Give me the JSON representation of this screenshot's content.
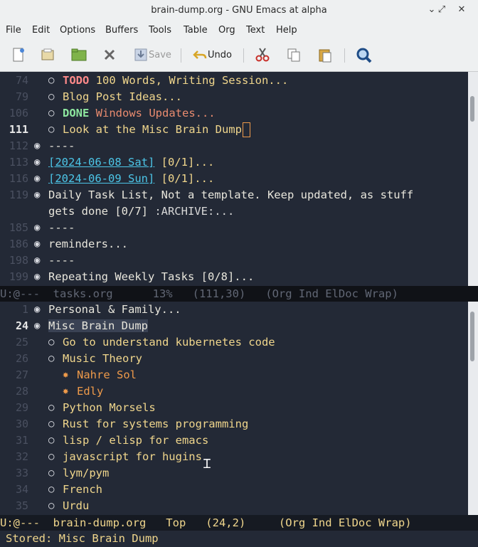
{
  "window": {
    "title": "brain-dump.org - GNU Emacs at alpha"
  },
  "menu": [
    "File",
    "Edit",
    "Options",
    "Buffers",
    "Tools",
    "Table",
    "Org",
    "Text",
    "Help"
  ],
  "toolbar": {
    "save": "Save",
    "undo": "Undo"
  },
  "top_pane": {
    "lines": [
      {
        "n": "74",
        "bullet": "○",
        "lvl": 2,
        "kw": "TODO",
        "kwtype": "todo",
        "text": "100 Words, Writing Session..."
      },
      {
        "n": "79",
        "bullet": "○",
        "lvl": 2,
        "text": "Blog Post Ideas..."
      },
      {
        "n": "106",
        "bullet": "○",
        "lvl": 2,
        "kw": "DONE",
        "kwtype": "done",
        "text": "Windows Updates..."
      },
      {
        "n": "111",
        "bullet": "○",
        "lvl": 2,
        "text": "Look at the Misc Brain Dump",
        "current": true
      },
      {
        "n": "112",
        "bullet": "◉",
        "lvl": 1,
        "text": "----"
      },
      {
        "n": "113",
        "bullet": "◉",
        "lvl": 1,
        "date": "[2024-06-08 Sat]",
        "text": " [0/1]..."
      },
      {
        "n": "116",
        "bullet": "◉",
        "lvl": 1,
        "date": "[2024-06-09 Sun]",
        "text": " [0/1]..."
      },
      {
        "n": "119",
        "bullet": "◉",
        "lvl": 1,
        "text": "Daily Task List, Not a template. Keep updated, as stuff"
      },
      {
        "n": "",
        "bullet": "",
        "lvl": 1,
        "text": "gets done [0/7] ",
        "tag": ":ARCHIVE:..."
      },
      {
        "n": "185",
        "bullet": "◉",
        "lvl": 1,
        "text": "----"
      },
      {
        "n": "186",
        "bullet": "◉",
        "lvl": 1,
        "text": "reminders..."
      },
      {
        "n": "198",
        "bullet": "◉",
        "lvl": 1,
        "text": "----"
      },
      {
        "n": "199",
        "bullet": "◉",
        "lvl": 1,
        "text": "Repeating Weekly Tasks [0/8]..."
      }
    ],
    "modeline": "U:@---  tasks.org      13%   (111,30)   (Org Ind ElDoc Wrap)"
  },
  "bottom_pane": {
    "lines": [
      {
        "n": "1",
        "bullet": "◉",
        "lvl": 1,
        "text": "Personal & Family..."
      },
      {
        "n": "24",
        "bullet": "◉",
        "lvl": 1,
        "text": "Misc Brain Dump",
        "current": true
      },
      {
        "n": "25",
        "bullet": "○",
        "lvl": 2,
        "text": "Go to understand kubernetes code"
      },
      {
        "n": "26",
        "bullet": "○",
        "lvl": 2,
        "text": "Music Theory"
      },
      {
        "n": "27",
        "bullet": "✸",
        "lvl": 3,
        "text": "Nahre Sol"
      },
      {
        "n": "28",
        "bullet": "✸",
        "lvl": 3,
        "text": "Edly"
      },
      {
        "n": "29",
        "bullet": "○",
        "lvl": 2,
        "text": "Python Morsels"
      },
      {
        "n": "30",
        "bullet": "○",
        "lvl": 2,
        "text": "Rust for systems programming"
      },
      {
        "n": "31",
        "bullet": "○",
        "lvl": 2,
        "text": "lisp / elisp for emacs"
      },
      {
        "n": "32",
        "bullet": "○",
        "lvl": 2,
        "text": "javascript for hugins"
      },
      {
        "n": "33",
        "bullet": "○",
        "lvl": 2,
        "text": "lym/pym"
      },
      {
        "n": "34",
        "bullet": "○",
        "lvl": 2,
        "text": "French"
      },
      {
        "n": "35",
        "bullet": "○",
        "lvl": 2,
        "text": "Urdu"
      }
    ],
    "modeline": "U:@---  brain-dump.org   Top   (24,2)     (Org Ind ElDoc Wrap)"
  },
  "echo": "Stored: Misc Brain Dump"
}
